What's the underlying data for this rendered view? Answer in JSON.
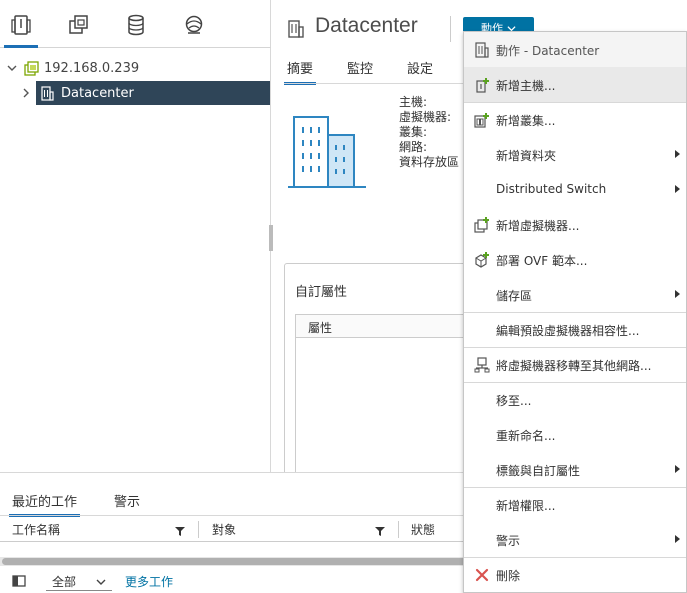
{
  "nav": {
    "tabs": [
      {
        "icon": "hosts-clusters-icon"
      },
      {
        "icon": "vms-templates-icon"
      },
      {
        "icon": "storage-icon"
      },
      {
        "icon": "networking-icon"
      }
    ],
    "tree": {
      "vcenter": "192.168.0.239",
      "datacenter": "Datacenter"
    }
  },
  "header": {
    "title": "Datacenter",
    "actions_label": "動作"
  },
  "tabs": [
    "摘要",
    "監控",
    "設定"
  ],
  "summary": {
    "fields": [
      "主機:",
      "虛擬機器:",
      "叢集:",
      "網路:",
      "資料存放區"
    ]
  },
  "custom_attributes": {
    "title": "自訂屬性",
    "column": "屬性"
  },
  "bottom": {
    "tabs": [
      "最近的工作",
      "警示"
    ],
    "columns": [
      "工作名稱",
      "對象",
      "狀態"
    ],
    "filter_value": "全部",
    "more_tasks": "更多工作"
  },
  "menu": {
    "header": "動作 - Datacenter",
    "items": [
      {
        "label": "新增主機...",
        "icon": "add-host-icon",
        "submenu": false
      },
      {
        "label": "新增叢集...",
        "icon": "add-cluster-icon",
        "submenu": false
      },
      {
        "label": "新增資料夾",
        "icon": "",
        "submenu": true
      },
      {
        "label": "Distributed Switch",
        "icon": "",
        "submenu": true
      },
      {
        "label": "新增虛擬機器...",
        "icon": "new-vm-icon",
        "submenu": false
      },
      {
        "label": "部署 OVF 範本...",
        "icon": "deploy-ovf-icon",
        "submenu": false
      },
      {
        "label": "儲存區",
        "icon": "",
        "submenu": true
      },
      {
        "label": "編輯預設虛擬機器相容性...",
        "icon": "",
        "submenu": false
      },
      {
        "label": "將虛擬機器移轉至其他網路...",
        "icon": "migrate-network-icon",
        "submenu": false
      },
      {
        "label": "移至...",
        "icon": "",
        "submenu": false
      },
      {
        "label": "重新命名...",
        "icon": "",
        "submenu": false
      },
      {
        "label": "標籤與自訂屬性",
        "icon": "",
        "submenu": true
      },
      {
        "label": "新增權限...",
        "icon": "",
        "submenu": false
      },
      {
        "label": "警示",
        "icon": "",
        "submenu": true
      },
      {
        "label": "刪除",
        "icon": "delete-icon",
        "submenu": false
      }
    ]
  },
  "colors": {
    "accent": "#0072a3",
    "tab_underline": "#1c6fb5",
    "selected_row": "#2f4558",
    "delete_red": "#d9534f",
    "add_green": "#5aa220"
  }
}
